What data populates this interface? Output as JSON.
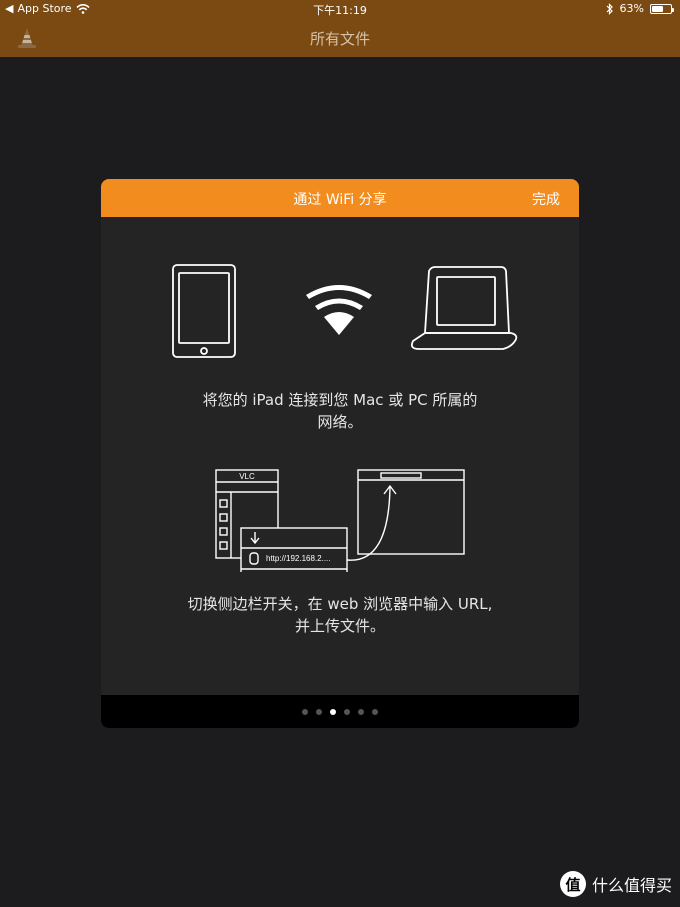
{
  "status_bar": {
    "carrier_back": "App Store",
    "time": "下午11:19",
    "battery": "63%",
    "battery_level": 0.63
  },
  "nav": {
    "title": "所有文件",
    "left_icon": "vlc-cone-icon"
  },
  "modal": {
    "title": "通过 WiFi 分享",
    "done_label": "完成",
    "step1_line1": "将您的 iPad 连接到您 Mac 或 PC 所属的",
    "step1_line2": "网络。",
    "step2_line1": "切换侧边栏开关，在 web 浏览器中输入 URL,",
    "step2_line2": "并上传文件。",
    "illustration": {
      "app_label": "VLC",
      "url_text": "http://192.168.2...."
    },
    "pages": {
      "count": 6,
      "current": 3
    }
  },
  "watermark": {
    "icon_text": "值",
    "text": "什么值得买"
  },
  "colors": {
    "nav_bar": "#7a4a12",
    "accent": "#f28c1e",
    "background": "#1c1c1e"
  }
}
